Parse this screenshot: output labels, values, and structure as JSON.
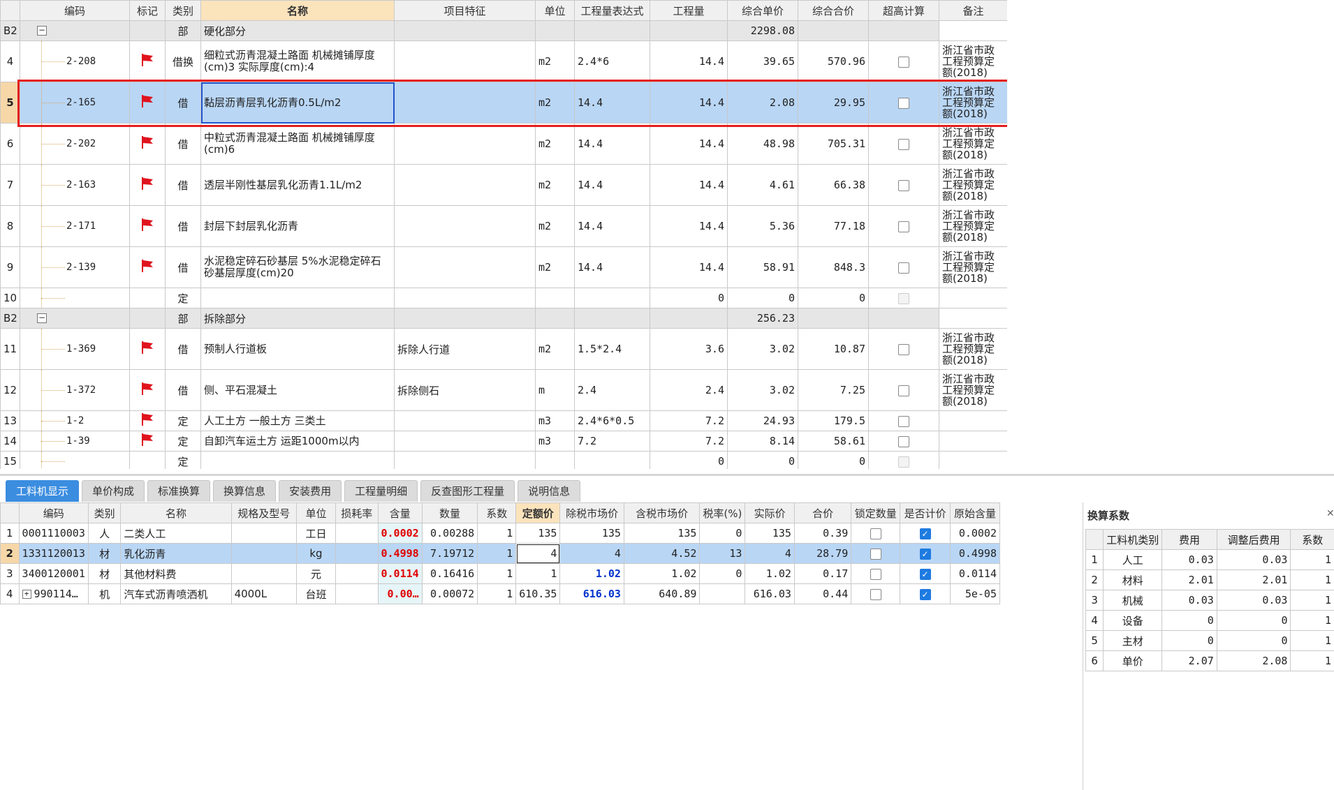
{
  "top_table": {
    "headers": [
      "编码",
      "标记",
      "类别",
      "名称",
      "项目特征",
      "单位",
      "工程量表达式",
      "工程量",
      "综合单价",
      "综合合价",
      "超高计算",
      "备注"
    ],
    "rows": [
      {
        "type": "section",
        "no": "B2",
        "category": "部",
        "name": "硬化部分",
        "total": "2298.08"
      },
      {
        "type": "item",
        "no": "4",
        "code": "2-208",
        "flag": true,
        "category": "借换",
        "name": "细粒式沥青混凝土路面 机械摊铺厚度(cm)3  实际厚度(cm):4",
        "feature": "",
        "unit": "m2",
        "expr": "2.4*6",
        "qty": "14.4",
        "price": "39.65",
        "total": "570.96",
        "checkbox": "off",
        "remark": "浙江省市政工程预算定额(2018)"
      },
      {
        "type": "item",
        "no": "5",
        "code": "2-165",
        "flag": true,
        "category": "借",
        "name": "黏层沥青层乳化沥青0.5L/m2",
        "feature": "",
        "unit": "m2",
        "expr": "14.4",
        "qty": "14.4",
        "price": "2.08",
        "total": "29.95",
        "checkbox": "off",
        "remark": "浙江省市政工程预算定额(2018)",
        "selected": true
      },
      {
        "type": "item",
        "no": "6",
        "code": "2-202",
        "flag": true,
        "category": "借",
        "name": "中粒式沥青混凝土路面 机械摊铺厚度(cm)6",
        "feature": "",
        "unit": "m2",
        "expr": "14.4",
        "qty": "14.4",
        "price": "48.98",
        "total": "705.31",
        "checkbox": "off",
        "remark": "浙江省市政工程预算定额(2018)"
      },
      {
        "type": "item",
        "no": "7",
        "code": "2-163",
        "flag": true,
        "category": "借",
        "name": "透层半刚性基层乳化沥青1.1L/m2",
        "feature": "",
        "unit": "m2",
        "expr": "14.4",
        "qty": "14.4",
        "price": "4.61",
        "total": "66.38",
        "checkbox": "off",
        "remark": "浙江省市政工程预算定额(2018)"
      },
      {
        "type": "item",
        "no": "8",
        "code": "2-171",
        "flag": true,
        "category": "借",
        "name": "封层下封层乳化沥青",
        "feature": "",
        "unit": "m2",
        "expr": "14.4",
        "qty": "14.4",
        "price": "5.36",
        "total": "77.18",
        "checkbox": "off",
        "remark": "浙江省市政工程预算定额(2018)"
      },
      {
        "type": "item",
        "no": "9",
        "code": "2-139",
        "flag": true,
        "category": "借",
        "name": "水泥稳定碎石砂基层 5%水泥稳定碎石砂基层厚度(cm)20",
        "feature": "",
        "unit": "m2",
        "expr": "14.4",
        "qty": "14.4",
        "price": "58.91",
        "total": "848.3",
        "checkbox": "off",
        "remark": "浙江省市政工程预算定额(2018)"
      },
      {
        "type": "small",
        "no": "10",
        "code": "",
        "flag": false,
        "category": "定",
        "name": "",
        "feature": "",
        "unit": "",
        "expr": "",
        "qty": "0",
        "price": "0",
        "total": "0",
        "checkbox": "disabled",
        "remark": ""
      },
      {
        "type": "section",
        "no": "B2",
        "category": "部",
        "name": "拆除部分",
        "total": "256.23"
      },
      {
        "type": "item",
        "no": "11",
        "code": "1-369",
        "flag": true,
        "category": "借",
        "name": "预制人行道板",
        "feature": "拆除人行道",
        "unit": "m2",
        "expr": "1.5*2.4",
        "qty": "3.6",
        "price": "3.02",
        "total": "10.87",
        "checkbox": "off",
        "remark": "浙江省市政工程预算定额(2018)"
      },
      {
        "type": "item",
        "no": "12",
        "code": "1-372",
        "flag": true,
        "category": "借",
        "name": "侧、平石混凝土",
        "feature": "拆除侧石",
        "unit": "m",
        "expr": "2.4",
        "qty": "2.4",
        "price": "3.02",
        "total": "7.25",
        "checkbox": "off",
        "remark": "浙江省市政工程预算定额(2018)"
      },
      {
        "type": "small",
        "no": "13",
        "code": "1-2",
        "flag": true,
        "category": "定",
        "name": "人工土方 一般土方 三类土",
        "feature": "",
        "unit": "m3",
        "expr": "2.4*6*0.5",
        "qty": "7.2",
        "price": "24.93",
        "total": "179.5",
        "checkbox": "off",
        "remark": ""
      },
      {
        "type": "small",
        "no": "14",
        "code": "1-39",
        "flag": true,
        "category": "定",
        "name": "自卸汽车运土方 运距1000m以内",
        "feature": "",
        "unit": "m3",
        "expr": "7.2",
        "qty": "7.2",
        "price": "8.14",
        "total": "58.61",
        "checkbox": "off",
        "remark": ""
      },
      {
        "type": "small",
        "no": "15",
        "code": "",
        "flag": false,
        "category": "定",
        "name": "",
        "feature": "",
        "unit": "",
        "expr": "",
        "qty": "0",
        "price": "0",
        "total": "0",
        "checkbox": "disabled",
        "remark": ""
      }
    ]
  },
  "tabs": [
    "工料机显示",
    "单价构成",
    "标准换算",
    "换算信息",
    "安装费用",
    "工程量明细",
    "反查图形工程量",
    "说明信息"
  ],
  "active_tab": 0,
  "bottom_table": {
    "headers": [
      "编码",
      "类别",
      "名称",
      "规格及型号",
      "单位",
      "损耗率",
      "含量",
      "数量",
      "系数",
      "定额价",
      "除税市场价",
      "含税市场价",
      "税率(%)",
      "实际价",
      "合价",
      "锁定数量",
      "是否计价",
      "原始含量"
    ],
    "rows": [
      {
        "no": "1",
        "code": "0001110003",
        "cat": "人",
        "name": "二类人工",
        "spec": "",
        "unit": "工日",
        "loss": "",
        "content": "0.0002",
        "qty": "0.00288",
        "coef": "1",
        "quota": "135",
        "market": "135",
        "market_tax": "135",
        "tax": "0",
        "actual": "135",
        "total": "0.39",
        "lock": false,
        "priced": true,
        "orig": "0.0002",
        "market_blue": false
      },
      {
        "no": "2",
        "code": "1331120013",
        "cat": "材",
        "name": "乳化沥青",
        "spec": "",
        "unit": "kg",
        "loss": "",
        "content": "0.4998",
        "qty": "7.19712",
        "coef": "1",
        "quota": "4",
        "market": "4",
        "market_tax": "4.52",
        "tax": "13",
        "actual": "4",
        "total": "28.79",
        "lock": false,
        "priced": true,
        "orig": "0.4998",
        "market_blue": false,
        "selected": true
      },
      {
        "no": "3",
        "code": "3400120001",
        "cat": "材",
        "name": "其他材料费",
        "spec": "",
        "unit": "元",
        "loss": "",
        "content": "0.0114",
        "qty": "0.16416",
        "coef": "1",
        "quota": "1",
        "market": "1.02",
        "market_tax": "1.02",
        "tax": "0",
        "actual": "1.02",
        "total": "0.17",
        "lock": false,
        "priced": true,
        "orig": "0.0114",
        "market_blue": true
      },
      {
        "no": "4",
        "code": "990114…",
        "cat": "机",
        "name": "汽车式沥青喷洒机",
        "spec": "4000L",
        "unit": "台班",
        "loss": "",
        "content": "0.00…",
        "qty": "0.00072",
        "coef": "1",
        "quota": "610.35",
        "market": "616.03",
        "market_tax": "640.89",
        "tax": "",
        "actual": "616.03",
        "total": "0.44",
        "lock": false,
        "priced": true,
        "orig": "5e-05",
        "market_blue": true,
        "expandable": true
      }
    ]
  },
  "coef_panel": {
    "title": "换算系数",
    "headers": [
      "工料机类别",
      "费用",
      "调整后费用",
      "系数"
    ],
    "rows": [
      {
        "no": "1",
        "cat": "人工",
        "fee": "0.03",
        "adj": "0.03",
        "coef": "1"
      },
      {
        "no": "2",
        "cat": "材料",
        "fee": "2.01",
        "adj": "2.01",
        "coef": "1"
      },
      {
        "no": "3",
        "cat": "机械",
        "fee": "0.03",
        "adj": "0.03",
        "coef": "1"
      },
      {
        "no": "4",
        "cat": "设备",
        "fee": "0",
        "adj": "0",
        "coef": "1"
      },
      {
        "no": "5",
        "cat": "主材",
        "fee": "0",
        "adj": "0",
        "coef": "1"
      },
      {
        "no": "6",
        "cat": "单价",
        "fee": "2.07",
        "adj": "2.08",
        "coef": "1"
      }
    ]
  },
  "colors": {
    "accent": "#3b8de0",
    "selection": "#b9d6f5",
    "flag": "#e0141e",
    "highlight_frame": "#e3201f",
    "emphasis_red": "#e00000",
    "emphasis_blue": "#0033cc"
  },
  "icons": {
    "flag": "flag-icon",
    "collapse": "minus-box-icon",
    "expand": "plus-box-icon",
    "checkbox": "checkbox-icon",
    "close": "close-icon"
  }
}
